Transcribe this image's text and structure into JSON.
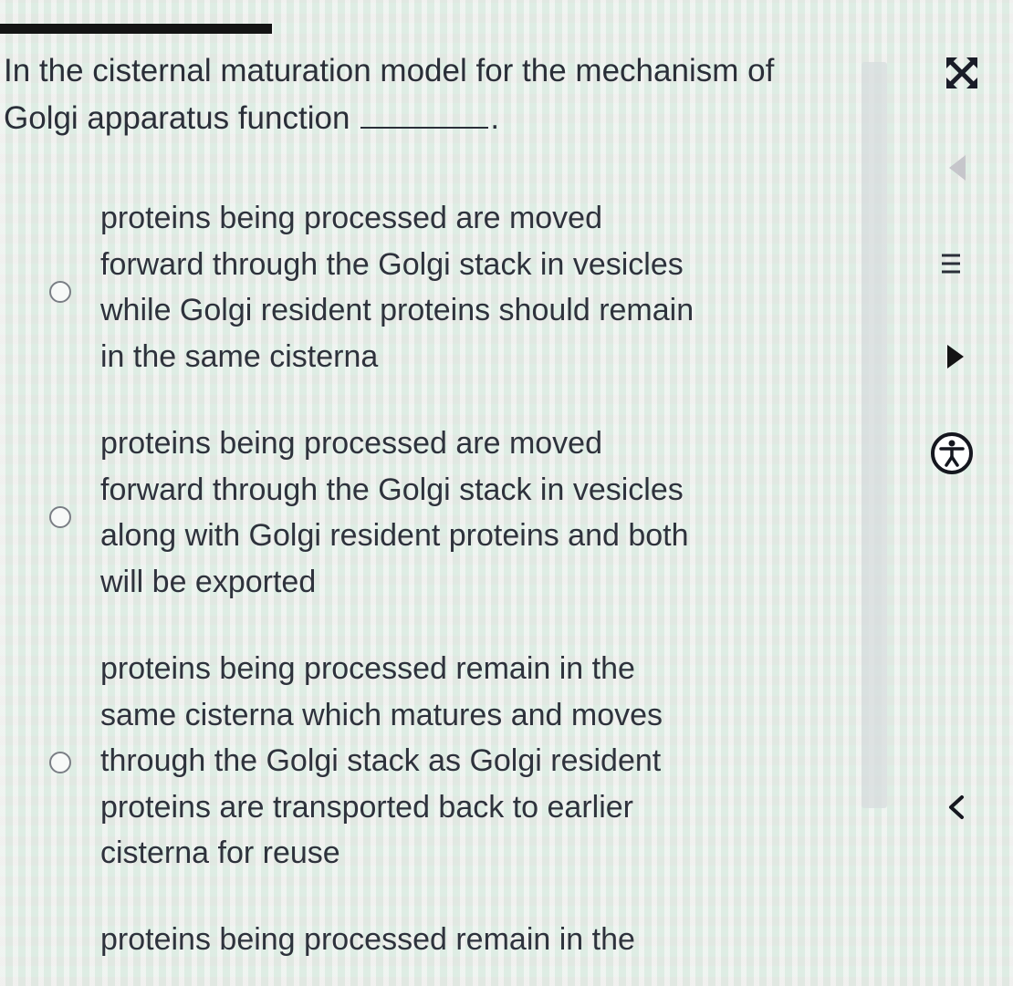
{
  "question": {
    "line1": "In the cisternal maturation model for the mechanism of",
    "line2": "Golgi apparatus function",
    "suffix": "."
  },
  "options": [
    {
      "lines": [
        "proteins being processed are moved",
        "forward through the Golgi stack in vesicles",
        "while Golgi resident proteins should remain",
        "in the same cisterna"
      ]
    },
    {
      "lines": [
        "proteins being processed are moved",
        "forward through the Golgi stack in vesicles",
        "along with Golgi resident proteins and both",
        "will be exported"
      ]
    },
    {
      "lines": [
        "proteins being processed remain in the",
        "same cisterna which matures and moves",
        "through the Golgi stack as Golgi resident",
        "proteins are transported back to earlier",
        "cisterna for reuse"
      ]
    },
    {
      "lines": [
        "proteins being processed remain in the"
      ]
    }
  ],
  "sidebar_icons": [
    "expand-icon",
    "collapse-left-icon",
    "menu-icon",
    "play-icon",
    "accessibility-icon",
    "chevron-left-icon"
  ]
}
